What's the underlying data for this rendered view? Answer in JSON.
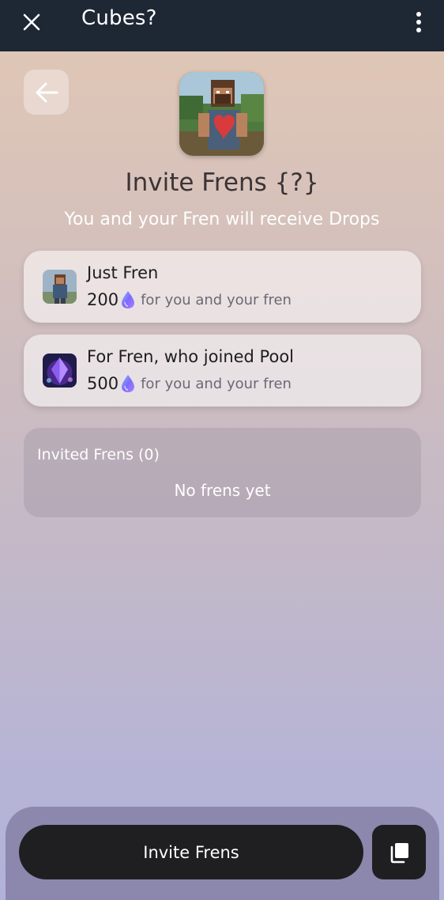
{
  "window": {
    "title": "Cubes?",
    "close_icon": "close-icon",
    "menu_icon": "more-vertical-icon"
  },
  "page": {
    "back_icon": "arrow-left-icon",
    "hero_image": "minecraft-character-with-heart",
    "heading": "Invite Frens {?}",
    "subheading": "You and your Fren will receive Drops"
  },
  "rewards": [
    {
      "title": "Just Fren",
      "amount": "200",
      "icon": "drop-icon",
      "desc": "for you and your fren",
      "thumb": "minecraft-character-thumbnail"
    },
    {
      "title": "For Fren, who joined Pool",
      "amount": "500",
      "icon": "drop-icon",
      "desc": "for you and your fren",
      "thumb": "purple-crystal-thumbnail"
    }
  ],
  "invited": {
    "title": "Invited Frens (0)",
    "empty_text": "No frens yet"
  },
  "footer": {
    "invite_label": "Invite Frens",
    "copy_icon": "copy-icon"
  },
  "colors": {
    "topbar_bg": "#1e2734",
    "button_dark": "#1f1f21",
    "bottom_bar": "#8c87ad"
  }
}
